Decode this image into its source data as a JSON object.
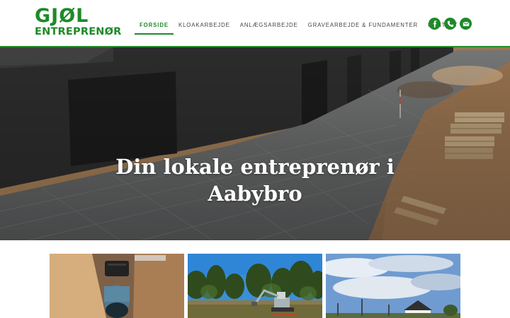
{
  "header": {
    "logo": {
      "line1": "GJØL",
      "line2": "ENTREPRENØR"
    },
    "nav": [
      {
        "label": "FORSIDE",
        "active": true
      },
      {
        "label": "KLOAKARBEJDE",
        "active": false
      },
      {
        "label": "ANLÆGSARBEJDE",
        "active": false
      },
      {
        "label": "GRAVEARBEJDE & FUNDAMENTER",
        "active": false
      },
      {
        "label": "KONTAKT",
        "active": false
      }
    ],
    "socials": [
      "facebook-icon",
      "phone-icon",
      "mail-icon"
    ]
  },
  "hero": {
    "title_line1": "Din lokale entreprenør i",
    "title_line2": "Aabybro"
  },
  "cards": [
    {
      "image": "sewer-pipe-trench-photo"
    },
    {
      "image": "excavator-forest-photo"
    },
    {
      "image": "sky-house-photo"
    }
  ],
  "colors": {
    "brand_green": "#1e8a29",
    "white": "#ffffff"
  }
}
